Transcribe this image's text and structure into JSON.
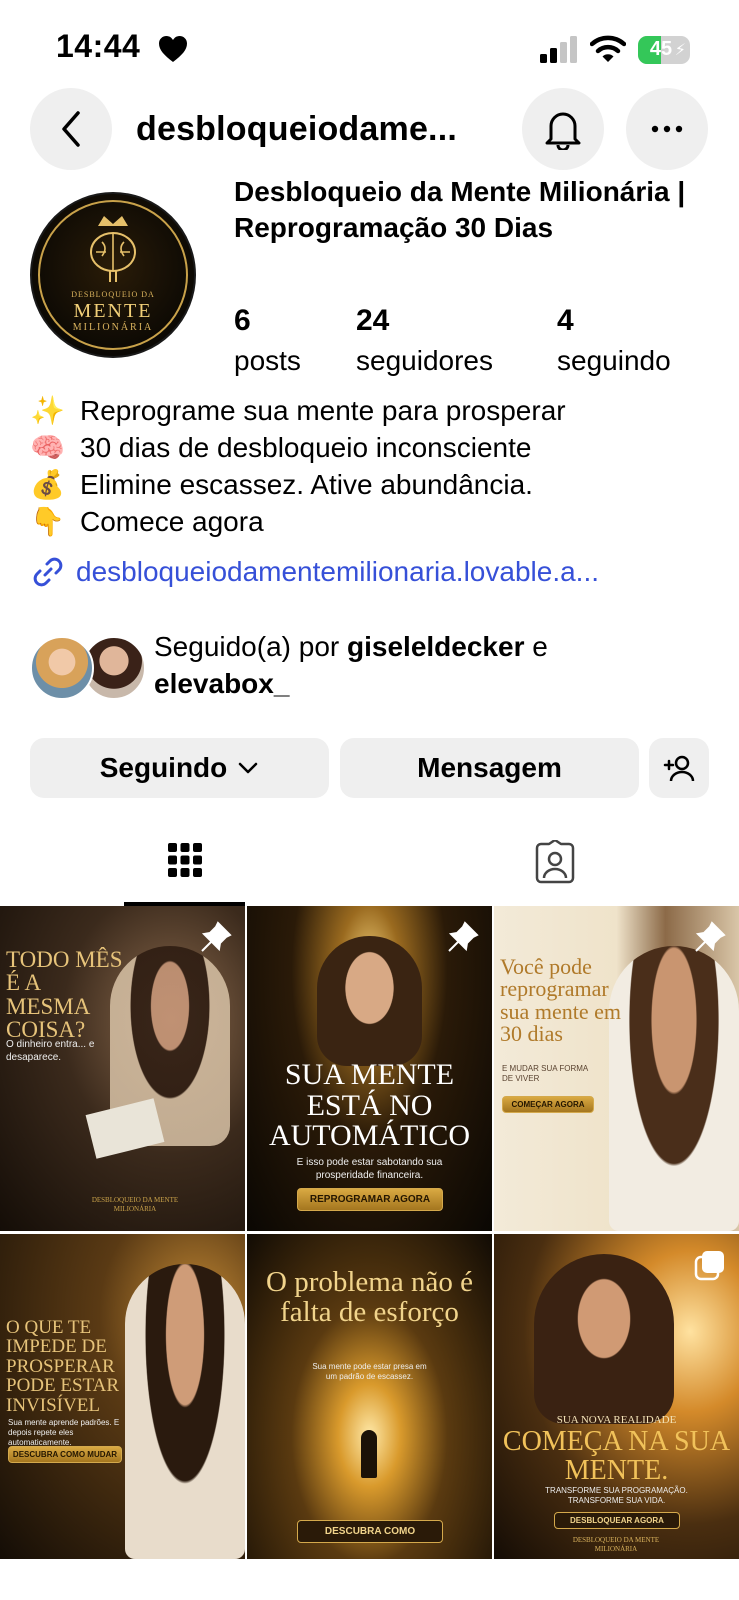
{
  "status_bar": {
    "time": "14:44",
    "battery": "45",
    "battery_level": 0.45
  },
  "header": {
    "username": "desbloqueiodame..."
  },
  "profile": {
    "full_name": "Desbloqueio da Mente Milionária | Reprogramação 30 Dias",
    "avatar_text": {
      "line1": "DESBLOQUEIO DA",
      "line2": "MENTE",
      "line3": "MILIONÁRIA"
    },
    "stats": [
      {
        "value": "6",
        "label": "posts"
      },
      {
        "value": "24",
        "label": "seguidores"
      },
      {
        "value": "4",
        "label": "seguindo"
      }
    ],
    "bio": [
      {
        "emoji": "✨",
        "text": "Reprograme sua mente para prosperar"
      },
      {
        "emoji": "🧠",
        "text": "30 dias de desbloqueio inconsciente"
      },
      {
        "emoji": "💰",
        "text": "Elimine escassez. Ative abundância."
      },
      {
        "emoji": "👇",
        "text": "Comece agora"
      }
    ],
    "link": "desbloqueiodamentemilionaria.lovable.a..."
  },
  "followed_by": {
    "prefix": "Seguido(a) por ",
    "user1": "giseleldecker",
    "conj": " e",
    "user2": "elevabox_"
  },
  "actions": {
    "following": "Seguindo",
    "message": "Mensagem"
  },
  "posts": [
    {
      "title": "TODO MÊS É A MESMA COISA?",
      "subtitle": "O dinheiro entra... e desaparece.",
      "footer": "DESBLOQUEIO DA MENTE MILIONÁRIA",
      "pinned": true
    },
    {
      "title": "SUA MENTE ESTÁ NO AUTOMÁTICO",
      "subtitle": "E isso pode estar sabotando sua prosperidade financeira.",
      "button": "REPROGRAMAR AGORA",
      "pinned": true
    },
    {
      "title": "Você pode reprogramar sua mente em 30 dias",
      "subtitle": "E MUDAR SUA FORMA DE VIVER",
      "button": "COMEÇAR AGORA",
      "pinned": true
    },
    {
      "title": "O QUE TE IMPEDE DE PROSPERAR PODE ESTAR INVISÍVEL",
      "subtitle": "Sua mente aprende padrões. E depois repete eles automaticamente.",
      "button": "DESCUBRA COMO MUDAR"
    },
    {
      "title": "O problema não é falta de esforço",
      "subtitle": "Sua mente pode estar presa em um padrão de escassez.",
      "button": "DESCUBRA COMO"
    },
    {
      "pre": "SUA NOVA REALIDADE",
      "title": "COMEÇA NA SUA MENTE.",
      "subtitle": "TRANSFORME SUA PROGRAMAÇÃO. TRANSFORME SUA VIDA.",
      "button": "DESBLOQUEAR AGORA",
      "footer": "DESBLOQUEIO DA MENTE MILIONÁRIA",
      "multi": true
    }
  ]
}
